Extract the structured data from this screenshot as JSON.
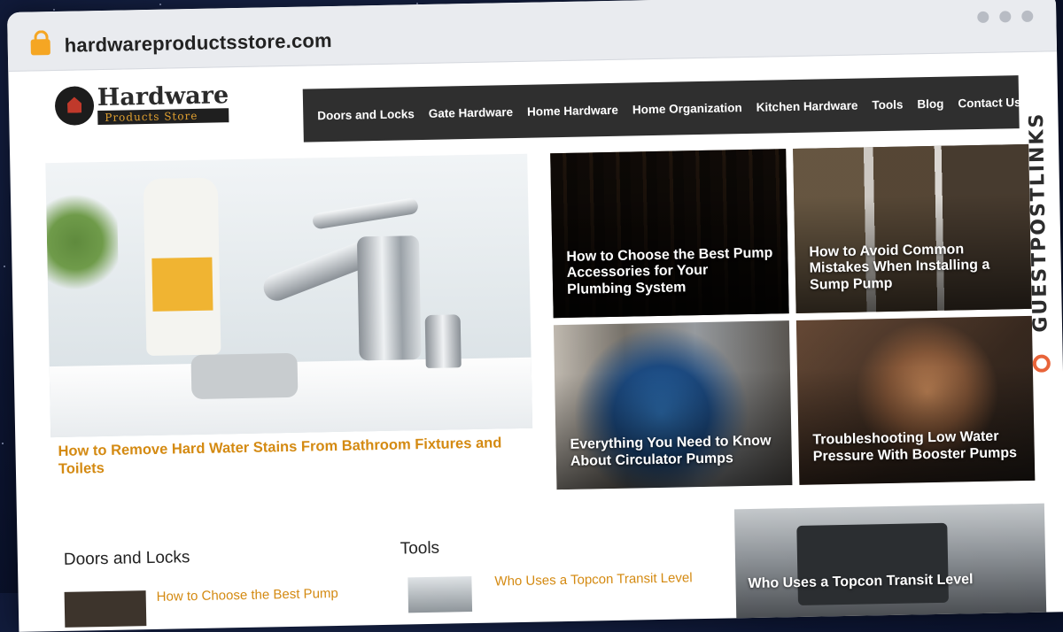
{
  "browser": {
    "url": "hardwareproductsstore.com",
    "icons": [
      "lock-icon",
      "window-dot-icon"
    ]
  },
  "logo": {
    "title": "Hardware",
    "subtitle": "Products Store"
  },
  "nav": {
    "items": [
      {
        "label": "Doors and Locks"
      },
      {
        "label": "Gate Hardware"
      },
      {
        "label": "Home Hardware"
      },
      {
        "label": "Home Organization"
      },
      {
        "label": "Kitchen Hardware"
      },
      {
        "label": "Tools"
      },
      {
        "label": "Blog"
      },
      {
        "label": "Contact Us"
      }
    ],
    "search_icon": "⌕"
  },
  "hero": {
    "title": "How to Remove Hard Water Stains From Bathroom Fixtures and Toilets"
  },
  "cards": [
    {
      "title": "How to Choose the Best Pump Accessories for Your Plumbing System"
    },
    {
      "title": "How to Avoid Common Mistakes When Installing a Sump Pump"
    },
    {
      "title": "Everything You Need to Know About Circulator Pumps"
    },
    {
      "title": "Troubleshooting Low Water Pressure With Booster Pumps"
    }
  ],
  "sections": {
    "doors": {
      "title": "Doors and Locks",
      "post": "How to Choose the Best Pump"
    },
    "tools": {
      "title": "Tools",
      "post": "Who Uses a Topcon Transit Level"
    },
    "feature": {
      "title": "Who Uses a Topcon Transit Level"
    }
  },
  "brand": {
    "text": "GUESTPOSTLINKS",
    "accent": "#e8643a"
  },
  "colors": {
    "link": "#d48a12",
    "nav_bg": "#2f2f2f"
  }
}
